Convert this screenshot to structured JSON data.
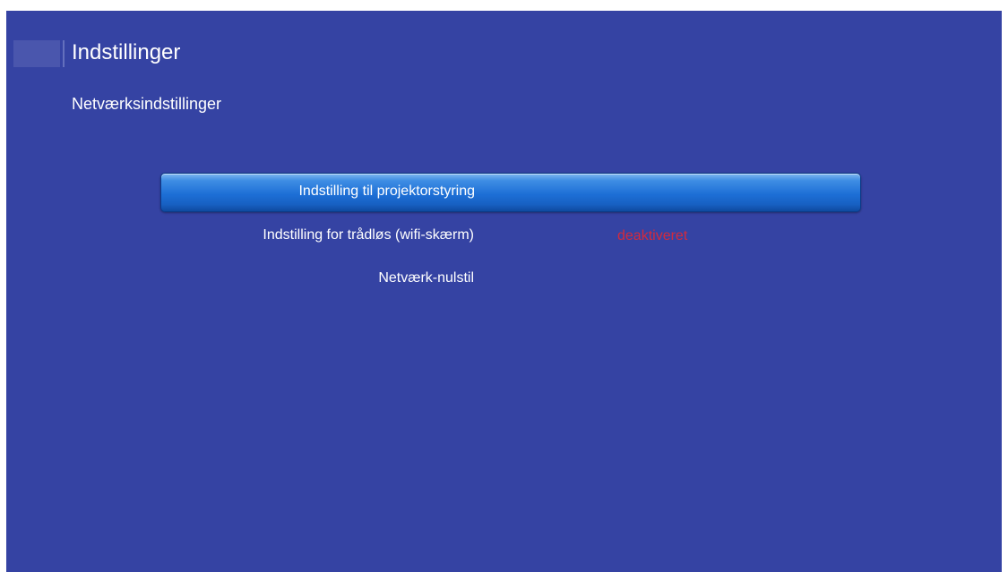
{
  "header": {
    "title": "Indstillinger",
    "subtitle": "Netværksindstillinger"
  },
  "menu": {
    "items": [
      {
        "label": "Indstilling til projektorstyring",
        "value": "",
        "selected": true
      },
      {
        "label": "Indstilling for trådløs (wifi-skærm)",
        "value": "deaktiveret",
        "selected": false
      },
      {
        "label": "Netværk-nulstil",
        "value": "",
        "selected": false
      }
    ]
  },
  "colors": {
    "background": "#3543a3",
    "highlight": "#1d6fd6",
    "disabled_value": "#d42a3c",
    "text": "#ffffff"
  }
}
